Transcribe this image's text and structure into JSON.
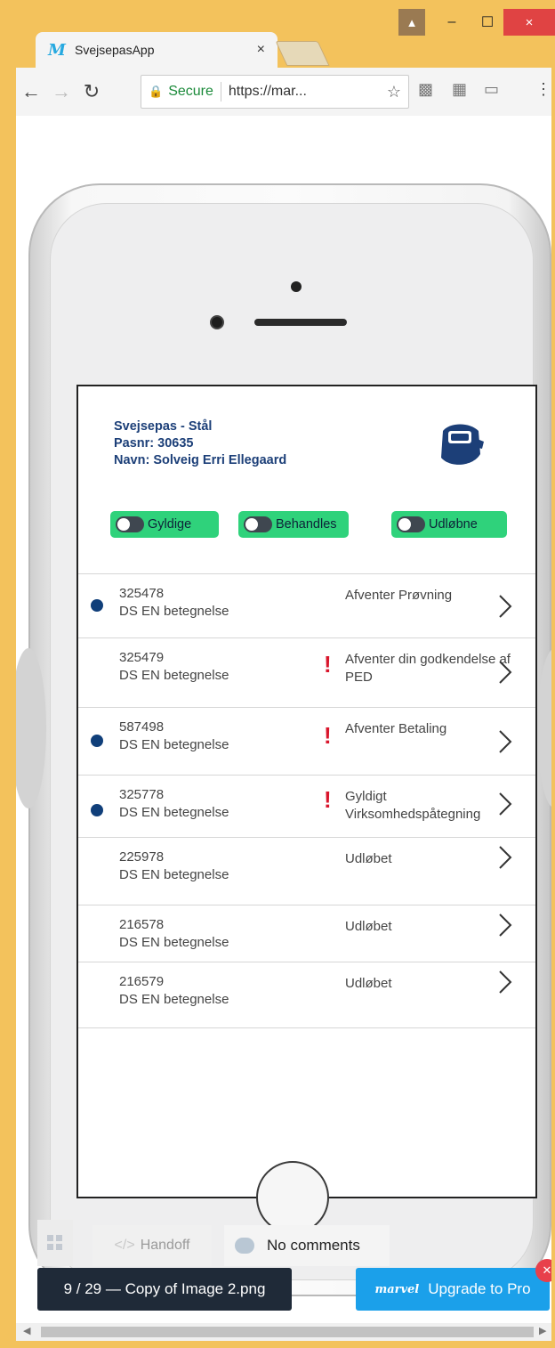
{
  "browser": {
    "tab_title": "SvejsepasApp",
    "tab_logo": "M",
    "tab_close": "×",
    "secure_label": "Secure",
    "url": "https://mar...",
    "window_controls": {
      "minimize": "–",
      "maximize": "☐",
      "close": "×"
    }
  },
  "header": {
    "line1": "Svejsepas - Stål",
    "line2": "Pasnr: 30635",
    "line3": "Navn: Solveig Erri Ellegaard",
    "icon": "welding-helmet-icon"
  },
  "filters": [
    {
      "label": "Gyldige"
    },
    {
      "label": "Behandles"
    },
    {
      "label": "Udløbne"
    }
  ],
  "items": [
    {
      "number": "325478",
      "subtitle": "DS EN betegnelse",
      "status": "Afventer Prøvning",
      "dot": true,
      "alert": false
    },
    {
      "number": "325479",
      "subtitle": "DS EN betegnelse",
      "status": "Afventer din godkendelse af PED",
      "dot": false,
      "alert": true
    },
    {
      "number": "587498",
      "subtitle": "DS EN betegnelse",
      "status": "Afventer Betaling",
      "dot": true,
      "alert": true
    },
    {
      "number": "325778",
      "subtitle": "DS EN betegnelse",
      "status": "Gyldigt Virksomhedspåtegning",
      "dot": true,
      "alert": true
    },
    {
      "number": "225978",
      "subtitle": "DS EN betegnelse",
      "status": "Udløbet",
      "dot": false,
      "alert": false
    },
    {
      "number": "216578",
      "subtitle": "DS EN betegnelse",
      "status": "Udløbet",
      "dot": false,
      "alert": false
    },
    {
      "number": "216579",
      "subtitle": "DS EN betegnelse",
      "status": "Udløbet",
      "dot": false,
      "alert": false
    }
  ],
  "marvel": {
    "handoff": "Handoff",
    "comments": "No comments",
    "page": "9 / 29 — Copy of Image 2.png",
    "logo": "marvel",
    "upgrade": "Upgrade to Pro"
  },
  "colors": {
    "brand_blue": "#1c3f78",
    "toggle_green": "#2fd27b",
    "alert_red": "#d9162c",
    "dot_blue": "#103f7a"
  }
}
